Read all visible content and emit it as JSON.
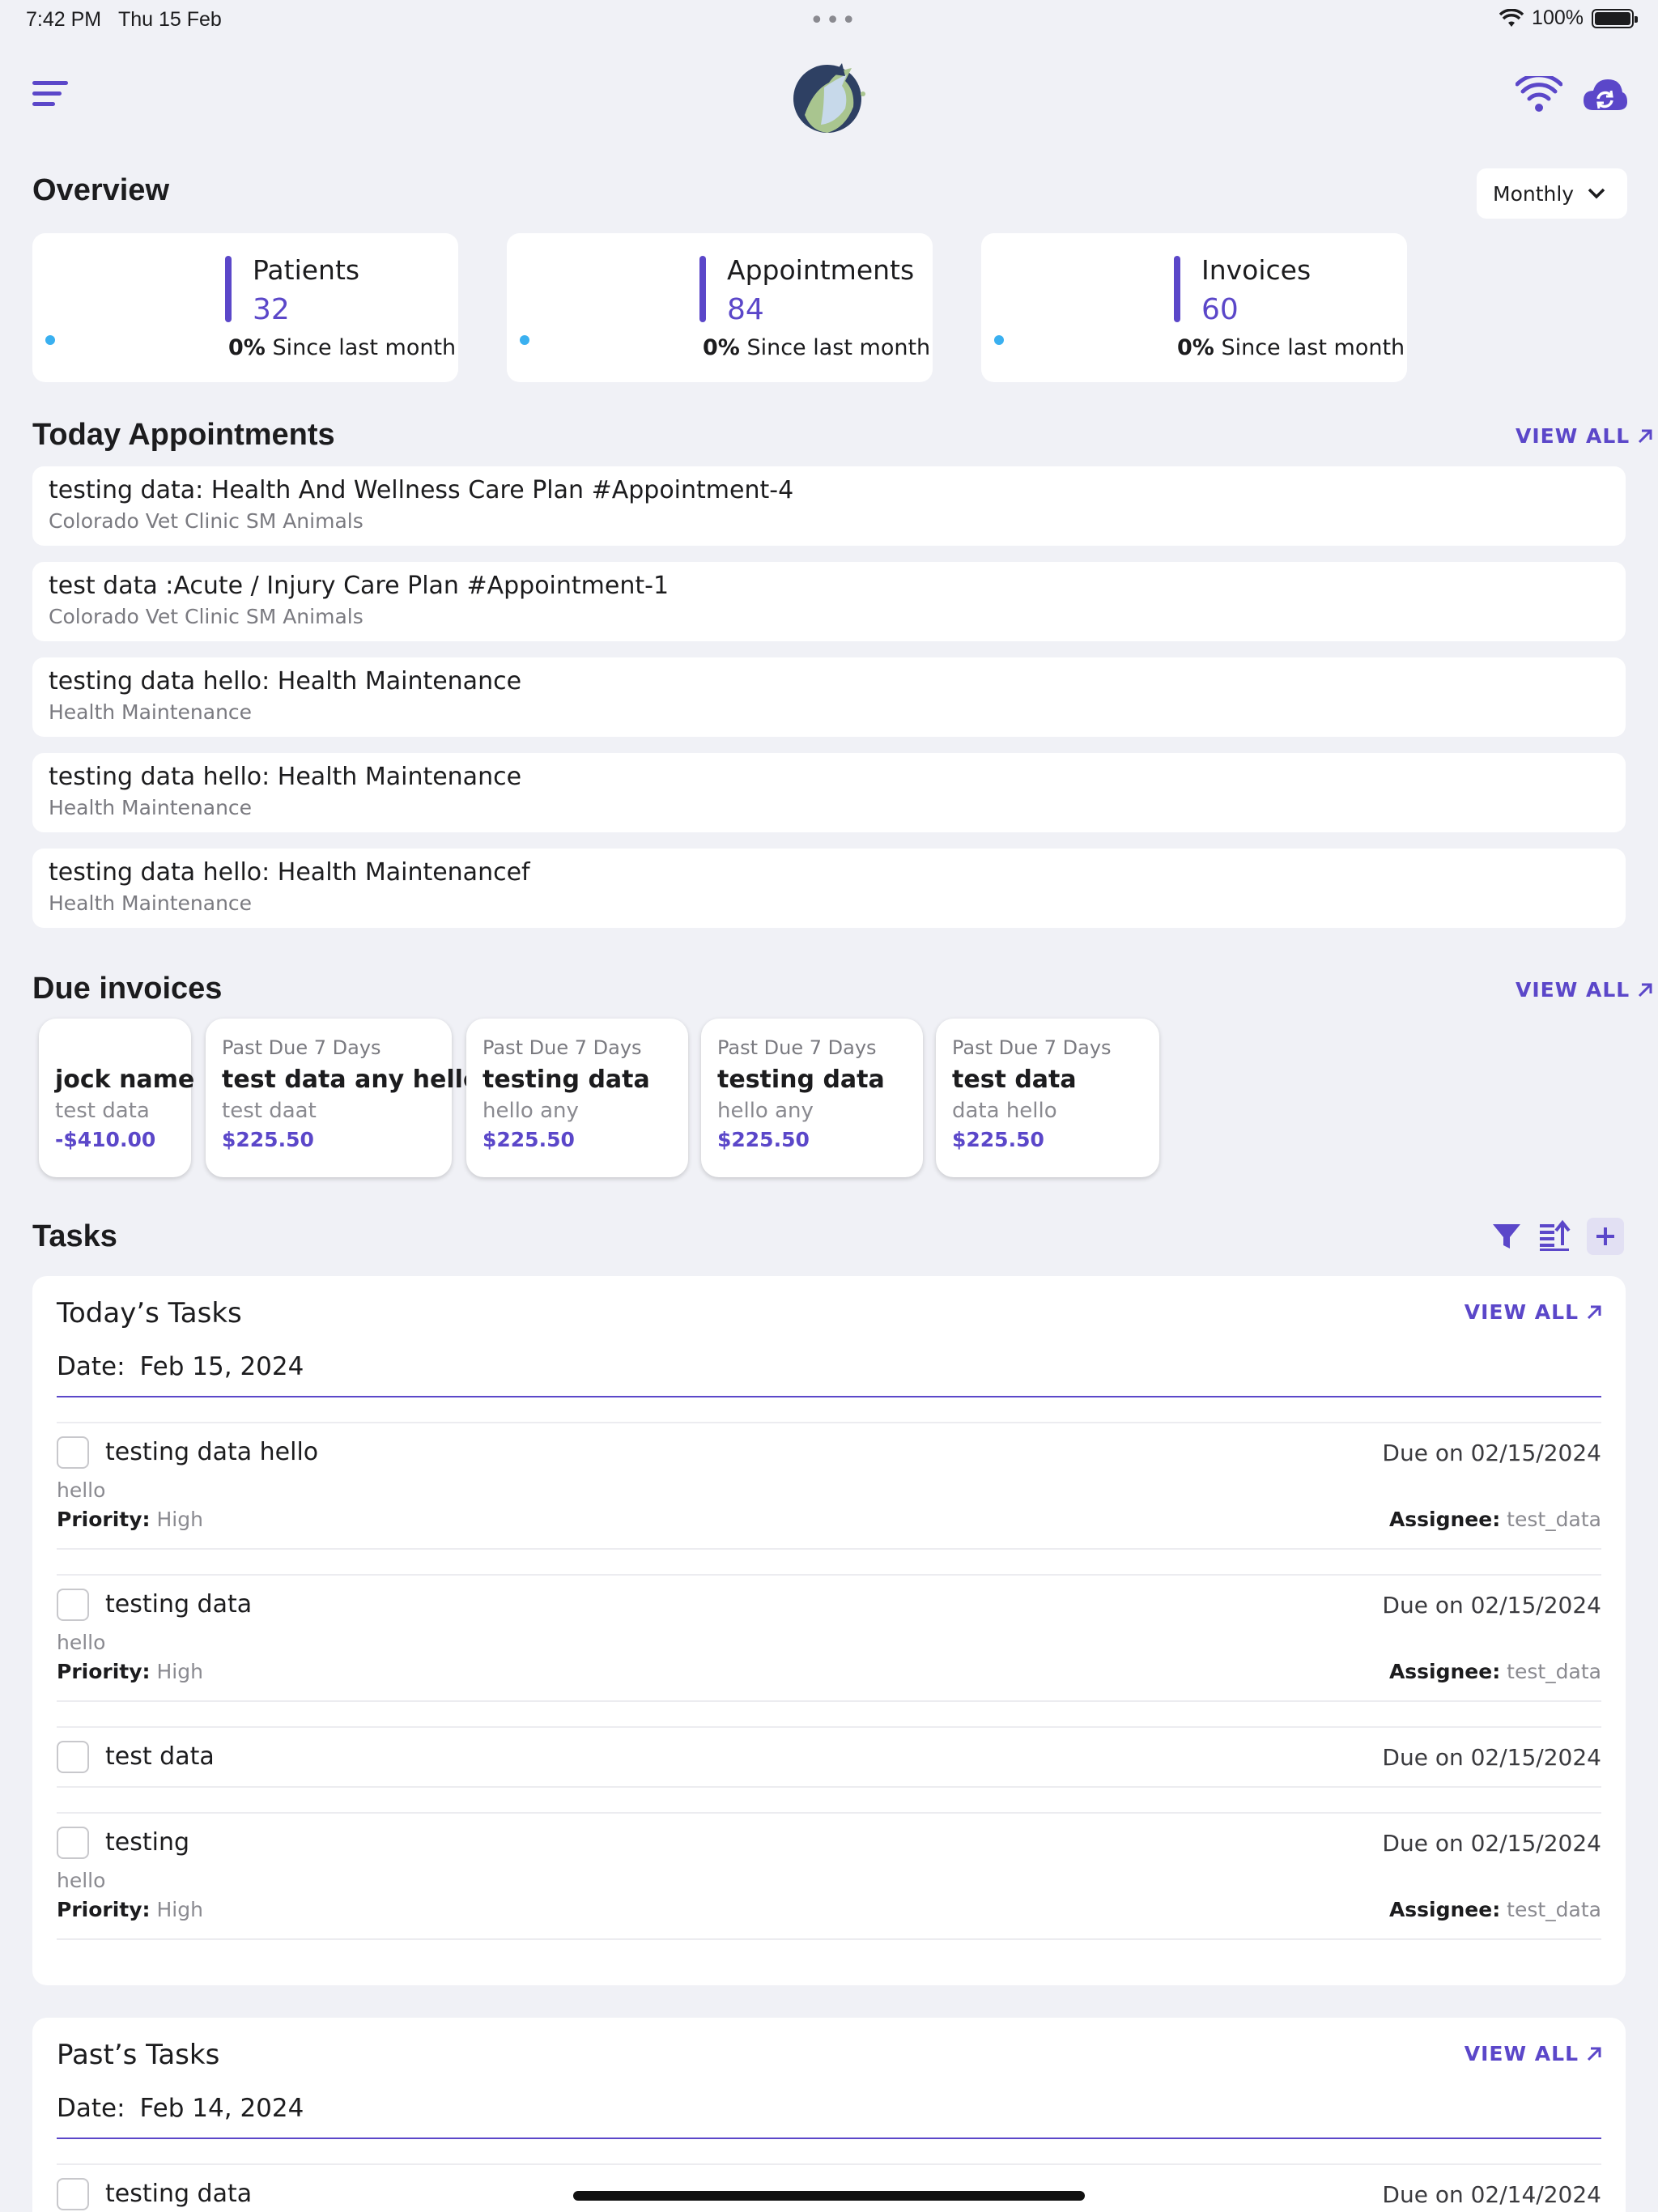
{
  "status_bar": {
    "time": "7:42 PM",
    "date": "Thu 15 Feb",
    "battery": "100%"
  },
  "overview": {
    "title": "Overview",
    "period": "Monthly",
    "stats": [
      {
        "label": "Patients",
        "value": "32",
        "change": "0%",
        "since": "Since last month"
      },
      {
        "label": "Appointments",
        "value": "84",
        "change": "0%",
        "since": "Since last month"
      },
      {
        "label": "Invoices",
        "value": "60",
        "change": "0%",
        "since": "Since last month"
      }
    ]
  },
  "appointments": {
    "title": "Today Appointments",
    "view_all": "VIEW ALL",
    "items": [
      {
        "title": "testing data: Health And Wellness Care Plan #Appointment-4",
        "subtitle": "Colorado Vet Clinic SM Animals"
      },
      {
        "title": "test data :Acute / Injury Care Plan #Appointment-1",
        "subtitle": "Colorado Vet Clinic SM Animals"
      },
      {
        "title": "testing data hello: Health Maintenance",
        "subtitle": "Health Maintenance"
      },
      {
        "title": "testing data hello: Health Maintenance",
        "subtitle": "Health Maintenance"
      },
      {
        "title": "testing data hello: Health Maintenancef",
        "subtitle": "Health Maintenance"
      }
    ]
  },
  "invoices": {
    "title": "Due invoices",
    "view_all": "VIEW ALL",
    "items": [
      {
        "status": "",
        "name": "jock name",
        "detail": "test data",
        "amount": "-$410.00"
      },
      {
        "status": "Past Due 7 Days",
        "name": "test data any hello",
        "detail": "test daat",
        "amount": "$225.50"
      },
      {
        "status": "Past Due 7 Days",
        "name": "testing data",
        "detail": "hello any",
        "amount": "$225.50"
      },
      {
        "status": "Past Due 7 Days",
        "name": "testing data",
        "detail": "hello any",
        "amount": "$225.50"
      },
      {
        "status": "Past Due 7 Days",
        "name": "test data",
        "detail": "data hello",
        "amount": "$225.50"
      }
    ]
  },
  "tasks": {
    "title": "Tasks",
    "today": {
      "title": "Today’s Tasks",
      "view_all": "VIEW ALL",
      "date_label": "Date:",
      "date": "Feb 15, 2024",
      "items": [
        {
          "title": "testing data hello",
          "due": "Due on 02/15/2024",
          "desc": "hello",
          "priority_label": "Priority:",
          "priority": "High",
          "assignee_label": "Assignee:",
          "assignee": "test_data"
        },
        {
          "title": "testing data",
          "due": "Due on 02/15/2024",
          "desc": "hello",
          "priority_label": "Priority:",
          "priority": "High",
          "assignee_label": "Assignee:",
          "assignee": "test_data"
        },
        {
          "title": "test data",
          "due": "Due on 02/15/2024"
        },
        {
          "title": "testing",
          "due": "Due on 02/15/2024",
          "desc": "hello",
          "priority_label": "Priority:",
          "priority": "High",
          "assignee_label": "Assignee:",
          "assignee": "test_data"
        }
      ]
    },
    "past": {
      "title": "Past’s Tasks",
      "view_all": "VIEW ALL",
      "date_label": "Date:",
      "date": "Feb 14, 2024",
      "items": [
        {
          "title": "testing data",
          "due": "Due on 02/14/2024"
        }
      ]
    }
  },
  "icons": {
    "menu": "hamburger-menu-icon",
    "logo": "horse-cat-dog-logo",
    "wifi": "wifi-icon",
    "sync": "cloud-sync-icon",
    "filter": "filter-icon",
    "sort": "sort-icon",
    "add": "plus-icon",
    "view_all": "arrow-up-right-icon",
    "dropdown": "chevron-down-icon"
  },
  "colors": {
    "accent": "#5b47c9",
    "background": "#f0f1f6",
    "dot": "#3ab0f0"
  }
}
